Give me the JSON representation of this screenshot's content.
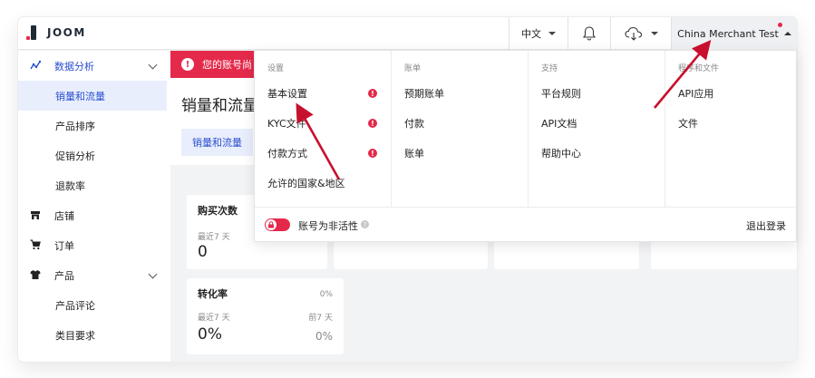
{
  "header": {
    "logo_text": "JOOM",
    "language": "中文",
    "merchant": "China Merchant Test"
  },
  "sidebar": {
    "groups": [
      {
        "label": "数据分析",
        "items": [
          "销量和流量",
          "产品排序",
          "促销分析",
          "退款率"
        ]
      },
      {
        "label": "店铺"
      },
      {
        "label": "订单"
      },
      {
        "label": "产品",
        "items": [
          "产品评论",
          "类目要求"
        ]
      }
    ]
  },
  "main": {
    "alert_text": "您的账号尚",
    "page_title": "销量和流量",
    "tab_label": "销量和流量",
    "stats": [
      {
        "label": "购买次数",
        "period": "最近7 天",
        "value": "0"
      },
      {
        "label": "转化率",
        "period": "最近7 天",
        "value": "0%",
        "right_tag": "0%",
        "right_period": "前7 天",
        "right_value": "0%"
      }
    ]
  },
  "dropdown": {
    "columns": [
      {
        "heading": "设置",
        "items": [
          {
            "label": "基本设置",
            "alert": true
          },
          {
            "label": "KYC文件",
            "alert": true
          },
          {
            "label": "付款方式",
            "alert": true
          },
          {
            "label": "允许的国家&地区",
            "alert": false
          }
        ]
      },
      {
        "heading": "账单",
        "items": [
          {
            "label": "预期账单"
          },
          {
            "label": "付款"
          },
          {
            "label": "账单"
          }
        ]
      },
      {
        "heading": "支持",
        "items": [
          {
            "label": "平台规则"
          },
          {
            "label": "API文档"
          },
          {
            "label": "帮助中心"
          }
        ]
      },
      {
        "heading": "程序和文件",
        "items": [
          {
            "label": "API应用"
          },
          {
            "label": "文件"
          }
        ]
      }
    ],
    "inactive_label": "账号为非活性",
    "logout_label": "退出登录",
    "toggle_on": true
  },
  "colors": {
    "accent_red": "#e5294b",
    "accent_blue": "#2a4fcf",
    "active_bg": "#e8eefc",
    "annotation_arrow": "#c8102e"
  }
}
